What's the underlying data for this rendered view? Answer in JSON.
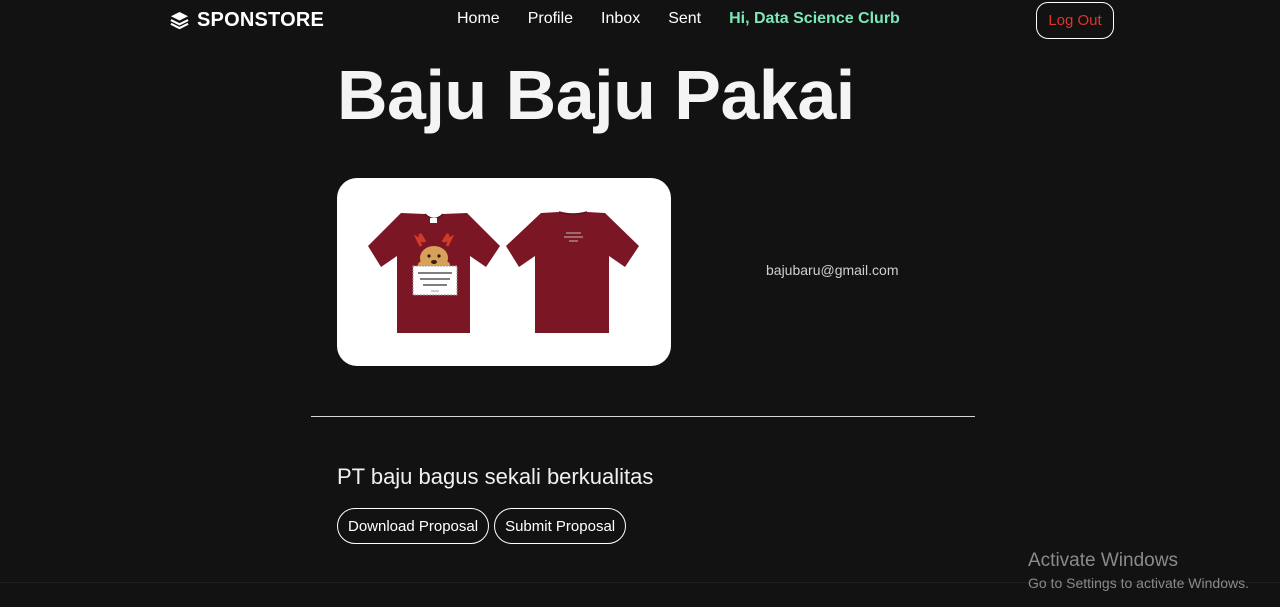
{
  "brand": {
    "name": "SPONSTORE",
    "icon": "layers-icon"
  },
  "nav": {
    "links": [
      "Home",
      "Profile",
      "Inbox",
      "Sent"
    ],
    "greeting": "Hi, Data Science Clurb",
    "logout_label": "Log Out"
  },
  "product": {
    "title": "Baju Baju Pakai",
    "email": "bajubaru@gmail.com",
    "description": "PT baju bagus sekali berkualitas",
    "image_alt": "Maroon t-shirt front and back"
  },
  "actions": {
    "download_label": "Download Proposal",
    "submit_label": "Submit Proposal"
  },
  "watermark": {
    "title": "Activate Windows",
    "subtitle": "Go to Settings to activate Windows."
  },
  "colors": {
    "background": "#121212",
    "greeting": "#7ee8b8",
    "logout": "#e0322c",
    "shirt": "#7b1624"
  }
}
